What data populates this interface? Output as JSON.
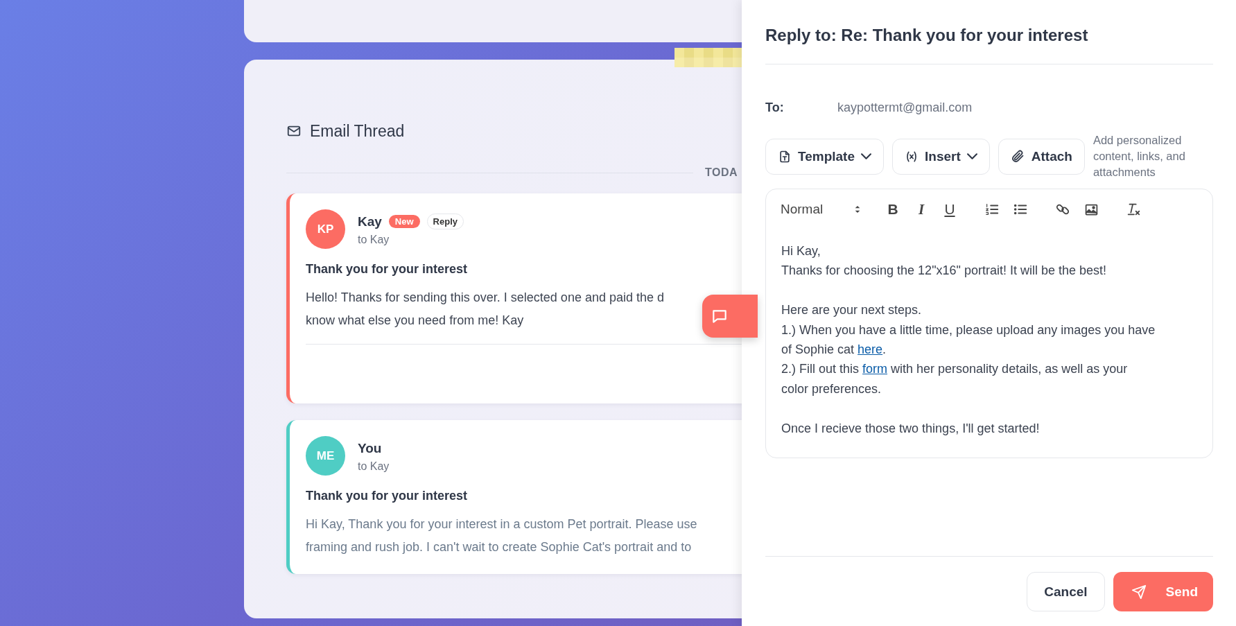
{
  "thread": {
    "title": "Email Thread",
    "date_divider": "TODA",
    "messages": [
      {
        "initials": "KP",
        "color": "#fc6c63",
        "sender": "Kay",
        "badge": "New",
        "action": "Reply",
        "recipient": "to Kay",
        "subject": "Thank you for your interest",
        "body": [
          "Hello! Thanks for sending this over. I selected one and paid the d",
          "know what else you need from me! Kay"
        ],
        "kind": "received",
        "expanded": true
      },
      {
        "initials": "ME",
        "color": "#4fcdc4",
        "sender": "You",
        "recipient": "to Kay",
        "subject": "Thank you for your interest",
        "body": [
          "Hi Kay, Thank you for your interest in a custom Pet portrait. Please use",
          "framing and rush job. I can't wait to create Sophie Cat's portrait and to"
        ],
        "kind": "sent",
        "expanded": false
      }
    ]
  },
  "reply": {
    "title": "Reply to: Re: Thank you for your interest",
    "to_label": "To:",
    "to_value": "kaypottermt@gmail.com",
    "actions": [
      {
        "kind": "template",
        "label": "Template",
        "dropdown": true
      },
      {
        "kind": "insert",
        "label": "Insert",
        "dropdown": true
      },
      {
        "kind": "attach",
        "label": "Attach",
        "dropdown": false
      }
    ],
    "actions_hint": "Add personalized content, links, and attachments",
    "editor": {
      "format": "Normal",
      "tools": [
        {
          "kind": "bold",
          "label": "B"
        },
        {
          "kind": "italic",
          "label": "I"
        },
        {
          "kind": "underline",
          "label": "U"
        },
        {
          "kind": "ordered-list"
        },
        {
          "kind": "bullet-list"
        },
        {
          "kind": "link"
        },
        {
          "kind": "image"
        },
        {
          "kind": "clear-format"
        }
      ],
      "groups": [
        [
          [
            {
              "text": "Hi Kay,"
            }
          ],
          [
            {
              "text": "Thanks for choosing the 12\"x16\" portrait! It will be the best!"
            }
          ]
        ],
        [
          [
            {
              "text": "Here are your next steps."
            }
          ],
          [
            {
              "text": "1.) When you have a little time, please upload any images you have"
            }
          ],
          [
            {
              "text": "of Sophie cat "
            },
            {
              "text": "here",
              "kind": "link"
            },
            {
              "text": "."
            }
          ],
          [
            {
              "text": "2.) Fill out this "
            },
            {
              "text": "form",
              "kind": "link"
            },
            {
              "text": " with her personality details, as well as your"
            }
          ],
          [
            {
              "text": "color preferences."
            }
          ]
        ],
        [
          [
            {
              "text": "Once I recieve those two things, I'll get started!"
            }
          ]
        ]
      ]
    },
    "buttons": [
      {
        "kind": "cancel",
        "label": "Cancel"
      },
      {
        "kind": "send",
        "label": "Send"
      }
    ]
  }
}
